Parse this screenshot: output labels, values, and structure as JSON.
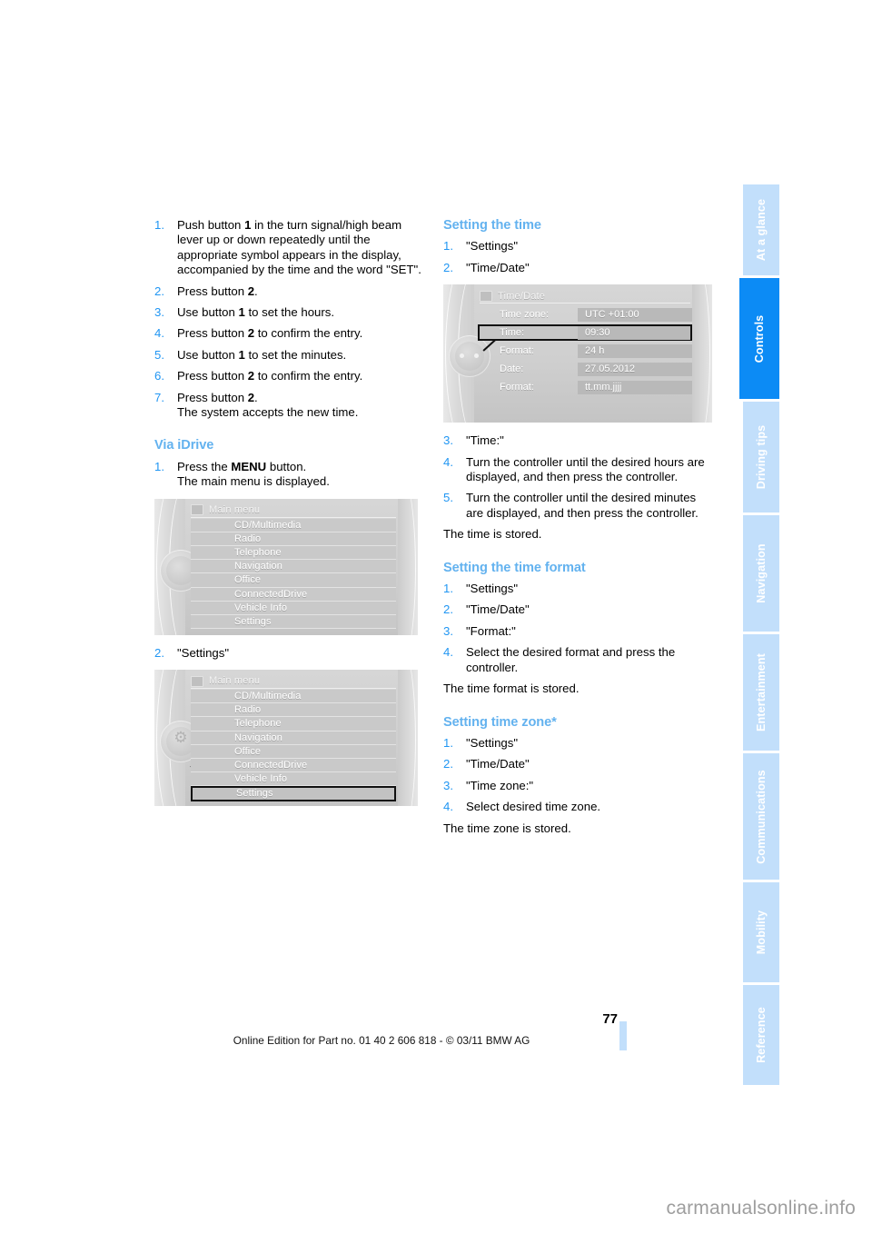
{
  "document": {
    "page_number": "77",
    "footer_text": "Online Edition for Part no. 01 40 2 606 818 - © 03/11 BMW AG",
    "watermark": "carmanualsonline.info",
    "accent_color": "#2196f3",
    "heading_color": "#63b2ef",
    "tab_active_color": "#0c8bf5",
    "tab_inactive_color": "#c2dffb"
  },
  "sidebar": {
    "tabs": [
      {
        "label": "At a glance",
        "active": false
      },
      {
        "label": "Controls",
        "active": true
      },
      {
        "label": "Driving tips",
        "active": false
      },
      {
        "label": "Navigation",
        "active": false
      },
      {
        "label": "Entertainment",
        "active": false
      },
      {
        "label": "Communications",
        "active": false
      },
      {
        "label": "Mobility",
        "active": false
      },
      {
        "label": "Reference",
        "active": false
      }
    ]
  },
  "left_column": {
    "steps_manual": [
      {
        "num": "1.",
        "text_before": "Push button ",
        "bold": "1",
        "text_after": " in the turn signal/high beam lever up or down repeatedly until the appropriate symbol appears in the display, accompanied by the time and the word \"SET\"."
      },
      {
        "num": "2.",
        "text_before": "Press button ",
        "bold": "2",
        "text_after": "."
      },
      {
        "num": "3.",
        "text_before": "Use button ",
        "bold": "1",
        "text_after": " to set the hours."
      },
      {
        "num": "4.",
        "text_before": "Press button ",
        "bold": "2",
        "text_after": " to confirm the entry."
      },
      {
        "num": "5.",
        "text_before": "Use button ",
        "bold": "1",
        "text_after": " to set the minutes."
      },
      {
        "num": "6.",
        "text_before": "Press button ",
        "bold": "2",
        "text_after": " to confirm the entry."
      },
      {
        "num": "7.",
        "text_before": "Press button ",
        "bold": "2",
        "text_after": ".",
        "sub": "The system accepts the new time."
      }
    ],
    "idrive_heading": "Via iDrive",
    "idrive_step1": {
      "num": "1.",
      "text_before": "Press the ",
      "bold": "MENU",
      "text_after": " button.",
      "sub": "The main menu is displayed."
    },
    "idrive_step2": {
      "num": "2.",
      "text": "\"Settings\""
    },
    "screenshot_main_menu": {
      "title": "Main menu",
      "items": [
        "CD/Multimedia",
        "Radio",
        "Telephone",
        "Navigation",
        "Office",
        "ConnectedDrive",
        "Vehicle Info",
        "Settings"
      ],
      "selected": null
    },
    "screenshot_main_menu_selected": {
      "title": "Main menu",
      "items": [
        "CD/Multimedia",
        "Radio",
        "Telephone",
        "Navigation",
        "Office",
        "ConnectedDrive",
        "Vehicle Info",
        "Settings"
      ],
      "selected": "Settings"
    }
  },
  "right_column": {
    "setting_time": {
      "heading": "Setting the time",
      "steps_before": [
        {
          "num": "1.",
          "text": "\"Settings\""
        },
        {
          "num": "2.",
          "text": "\"Time/Date\""
        }
      ],
      "steps_after": [
        {
          "num": "3.",
          "text": "\"Time:\""
        },
        {
          "num": "4.",
          "text": "Turn the controller until the desired hours are displayed, and then press the controller."
        },
        {
          "num": "5.",
          "text": "Turn the controller until the desired minutes are displayed, and then press the controller."
        }
      ],
      "result": "The time is stored."
    },
    "screenshot_time_date": {
      "title": "Time/Date",
      "rows": [
        {
          "key": "Time zone:",
          "value": "UTC +01:00",
          "selected": false
        },
        {
          "key": "Time:",
          "value": "09:30",
          "selected": true
        },
        {
          "key": "Format:",
          "value": "24 h",
          "selected": false
        },
        {
          "key": "Date:",
          "value": "27.05.2012",
          "selected": false
        },
        {
          "key": "Format:",
          "value": "tt.mm.jjjj",
          "selected": false
        }
      ]
    },
    "setting_time_format": {
      "heading": "Setting the time format",
      "steps": [
        {
          "num": "1.",
          "text": "\"Settings\""
        },
        {
          "num": "2.",
          "text": "\"Time/Date\""
        },
        {
          "num": "3.",
          "text": "\"Format:\""
        },
        {
          "num": "4.",
          "text": "Select the desired format and press the controller."
        }
      ],
      "result": "The time format is stored."
    },
    "setting_time_zone": {
      "heading": "Setting time zone*",
      "steps": [
        {
          "num": "1.",
          "text": "\"Settings\""
        },
        {
          "num": "2.",
          "text": "\"Time/Date\""
        },
        {
          "num": "3.",
          "text": "\"Time zone:\""
        },
        {
          "num": "4.",
          "text": "Select desired time zone."
        }
      ],
      "result": "The time zone is stored."
    }
  }
}
